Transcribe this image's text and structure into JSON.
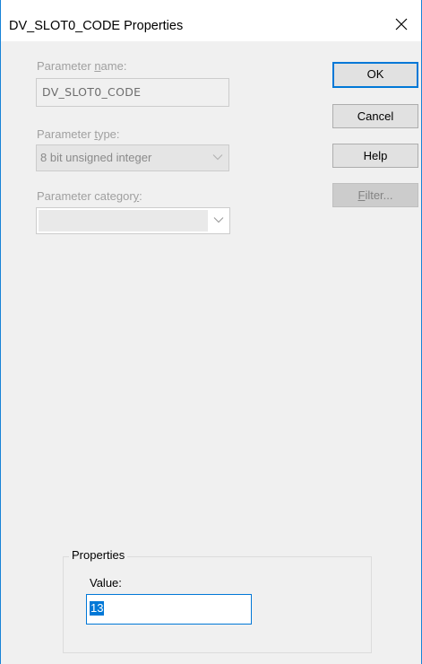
{
  "window": {
    "title": "DV_SLOT0_CODE Properties",
    "close_icon": "close-icon"
  },
  "fields": {
    "parameter_name": {
      "label_pre": "Parameter ",
      "label_accel": "n",
      "label_post": "ame:",
      "value": "DV_SLOT0_CODE"
    },
    "parameter_type": {
      "label_pre": "Parameter ",
      "label_accel": "t",
      "label_post": "ype:",
      "value": "8 bit unsigned integer"
    },
    "parameter_category": {
      "label_pre": "Parameter categor",
      "label_accel": "y",
      "label_post": ":",
      "value": ""
    }
  },
  "buttons": {
    "ok": "OK",
    "cancel": "Cancel",
    "help": "Help",
    "filter_accel": "F",
    "filter_rest": "ilter..."
  },
  "properties": {
    "group_title": "Properties",
    "value_label": "Value:",
    "value": "13"
  },
  "colors": {
    "accent": "#0078d7",
    "window_border": "#1883d7",
    "disabled_text": "#a0a0a0"
  }
}
